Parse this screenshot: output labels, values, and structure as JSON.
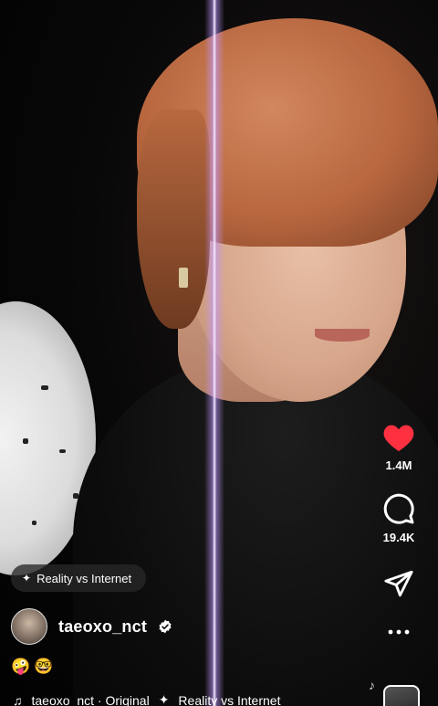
{
  "effect": {
    "label": "Reality vs Internet",
    "icon": "sparkles-icon"
  },
  "author": {
    "username": "taeoxo_nct",
    "verified": true
  },
  "caption_emojis": "🤪🤓",
  "audio": {
    "label": "taeoxo_nct · Original",
    "effect_label": "Reality vs Internet"
  },
  "actions": {
    "likes": "1.4M",
    "comments": "19.4K",
    "like_color": "#ff3040"
  }
}
